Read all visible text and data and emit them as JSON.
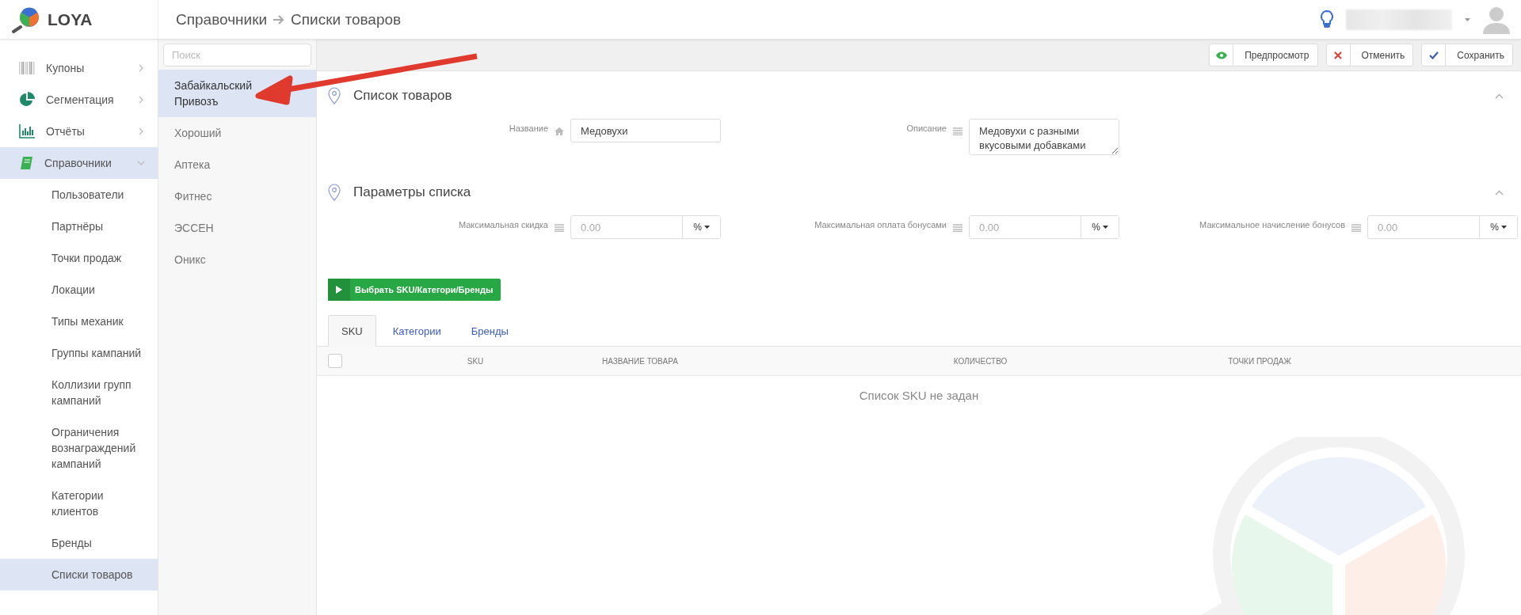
{
  "header": {
    "logo": "LOYA",
    "breadcrumb": [
      "Справочники",
      "Списки товаров"
    ]
  },
  "sidebar": {
    "items": [
      {
        "label": "Купоны",
        "selected": false,
        "expanded": false
      },
      {
        "label": "Сегментация",
        "selected": false,
        "expanded": false
      },
      {
        "label": "Отчёты",
        "selected": false,
        "expanded": false
      },
      {
        "label": "Справочники",
        "selected": true,
        "expanded": true,
        "children": [
          {
            "label": "Пользователи",
            "selected": false
          },
          {
            "label": "Партнёры",
            "selected": false
          },
          {
            "label": "Точки продаж",
            "selected": false
          },
          {
            "label": "Локации",
            "selected": false
          },
          {
            "label": "Типы механик",
            "selected": false
          },
          {
            "label": "Группы кампаний",
            "selected": false
          },
          {
            "label": "Коллизии групп кампаний",
            "selected": false
          },
          {
            "label": "Ограничения вознаграждений кампаний",
            "selected": false
          },
          {
            "label": "Категории клиентов",
            "selected": false
          },
          {
            "label": "Бренды",
            "selected": false
          },
          {
            "label": "Списки товаров",
            "selected": true
          }
        ]
      }
    ]
  },
  "list_panel": {
    "search": {
      "placeholder": "Поиск"
    },
    "items": [
      {
        "label": "Забайкальский Привозъ",
        "selected": true
      },
      {
        "label": "Хороший",
        "selected": false
      },
      {
        "label": "Аптека",
        "selected": false
      },
      {
        "label": "Фитнес",
        "selected": false
      },
      {
        "label": "ЭССЕН",
        "selected": false
      },
      {
        "label": "Оникс",
        "selected": false
      }
    ]
  },
  "toolbar": {
    "buttons": [
      {
        "label": "Предпросмотр",
        "kind": "preview"
      },
      {
        "label": "Отменить",
        "kind": "cancel"
      },
      {
        "label": "Сохранить",
        "kind": "save"
      }
    ]
  },
  "sections": [
    {
      "title": "Список товаров",
      "expanded": true,
      "fields": [
        {
          "label": "Название",
          "kind": "text",
          "value": "Медовухи"
        },
        {
          "label": "Описание",
          "kind": "textarea",
          "value": "Медовухи с разными вкусовыми добавками"
        }
      ]
    },
    {
      "title": "Параметры списка",
      "expanded": true,
      "fields": [
        {
          "label": "Максимальная скидка",
          "kind": "amount",
          "placeholder": "0.00",
          "unit": "%"
        },
        {
          "label": "Максимальная оплата бонусами",
          "kind": "amount",
          "placeholder": "0.00",
          "unit": "%"
        },
        {
          "label": "Максимальное начисление бонусов",
          "kind": "amount",
          "placeholder": "0.00",
          "unit": "%"
        }
      ]
    }
  ],
  "select_button": "Выбрать SKU/Категори/Бренды",
  "tabs": [
    {
      "label": "SKU",
      "selected": true
    },
    {
      "label": "Категории",
      "selected": false
    },
    {
      "label": "Бренды",
      "selected": false
    }
  ],
  "table": {
    "select_all_checked": false,
    "columns": [
      "SKU",
      "НАЗВАНИЕ ТОВАРА",
      "КОЛИЧЕСТВО",
      "ТОЧКИ ПРОДАЖ"
    ],
    "empty_text": "Список SKU не задан"
  }
}
